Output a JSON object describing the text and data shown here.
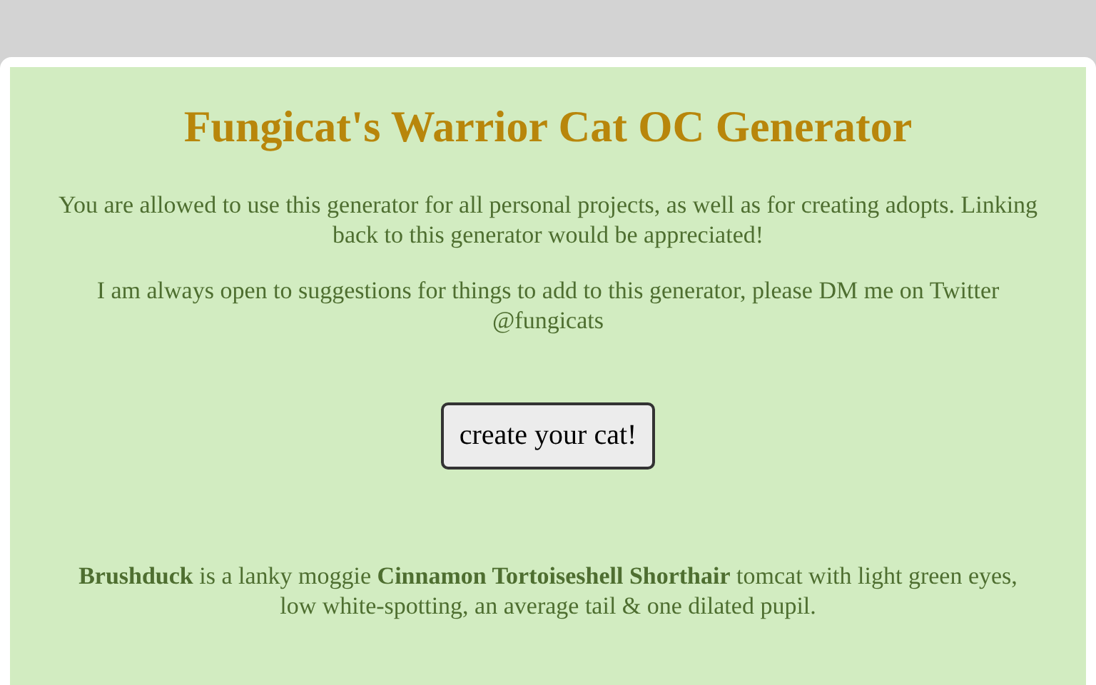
{
  "title": "Fungicat's Warrior Cat OC Generator",
  "paragraphs": [
    "You are allowed to use this generator for all personal projects, as well as for creating adopts. Linking back to this generator would be appreciated!",
    "I am always open to suggestions for things to add to this generator, please DM me on Twitter @fungicats"
  ],
  "button": {
    "label": "create your cat!"
  },
  "result": "**Brushduck** is a lanky moggie **Cinnamon Tortoiseshell Shorthair** tomcat with light green eyes, low white-spotting, an average tail & one dilated pupil."
}
